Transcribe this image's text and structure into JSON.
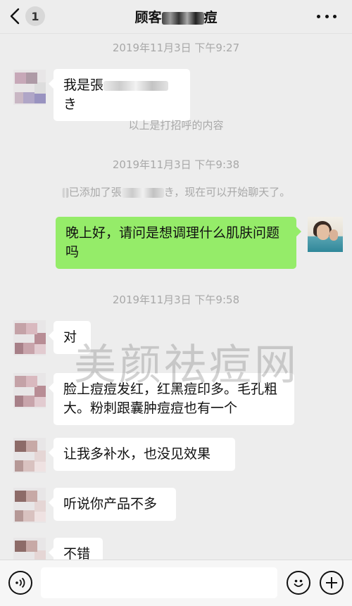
{
  "header": {
    "unread_count": "1",
    "title_prefix": "顾客",
    "title_suffix": "痘"
  },
  "messages": {
    "time1": "2019年11月3日  下午9:27",
    "greeting_prefix": "我是張",
    "greeting_suffix": "き",
    "note_greeting": "以上是打招呼的内容",
    "time2": "2019年11月3日  下午9:38",
    "added_prefix": "已添加了張",
    "added_suffix": "き，现在可以开始聊天了。",
    "outgoing_question": "晚上好，请问是想调理什么肌肤问题吗",
    "time3": "2019年11月3日  下午9:58",
    "reply_1": "对",
    "reply_2": "脸上痘痘发红，红黑痘印多。毛孔粗大。粉刺跟囊肿痘痘也有一个",
    "reply_3": "让我多补水，也没见效果",
    "reply_4": "听说你产品不多",
    "reply_5": "不错"
  },
  "watermark": "美颜祛痘网",
  "icons": {
    "back": "chevron-left-icon",
    "more": "more-dots-icon",
    "voice": "voice-icon",
    "emoji": "smiley-icon",
    "plus": "plus-icon"
  }
}
